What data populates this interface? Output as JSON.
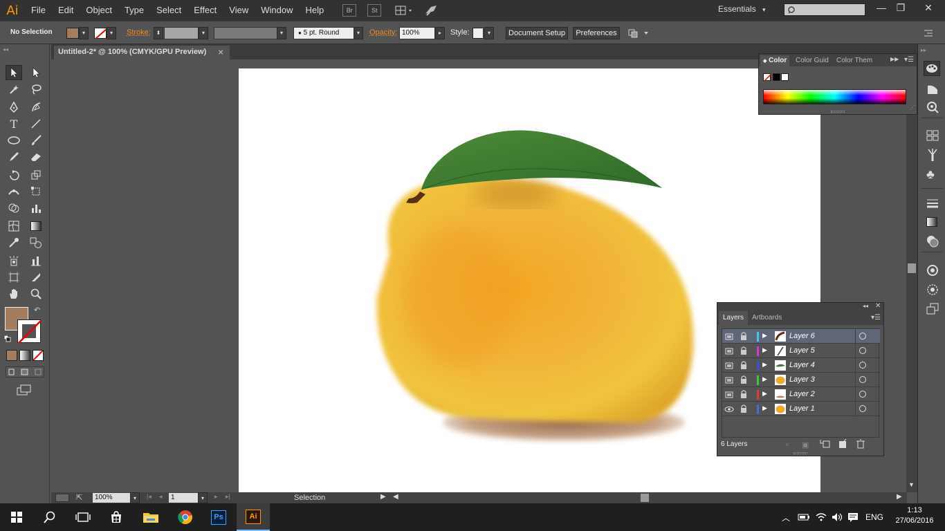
{
  "app": {
    "logo_text": "Ai"
  },
  "menu": [
    "File",
    "Edit",
    "Object",
    "Type",
    "Select",
    "Effect",
    "View",
    "Window",
    "Help"
  ],
  "menu_buttons": {
    "br": "Br",
    "st": "St"
  },
  "workspace": {
    "label": "Essentials",
    "arrow": "▾"
  },
  "window_controls": {
    "minimize": "—",
    "restore": "❐",
    "close": "✕"
  },
  "control_bar": {
    "selection_status": "No Selection",
    "stroke_label": "Stroke:",
    "brush_value": "5 pt. Round",
    "opacity_label": "Opacity:",
    "opacity_value": "100%",
    "style_label": "Style:",
    "document_setup": "Document Setup",
    "preferences": "Preferences"
  },
  "document_tab": {
    "title": "Untitled-2* @ 100% (CMYK/GPU Preview)",
    "close": "×"
  },
  "colors": {
    "fill": "#a47d5e",
    "accent_orange": "#f08a24",
    "selected_layer": "#5f6677"
  },
  "color_panel": {
    "tabs": [
      "Color",
      "Color Guide",
      "Color Themes"
    ],
    "tab_labels_visible": [
      "Color",
      "Color Guid",
      "Color Them"
    ]
  },
  "layers_panel": {
    "tabs": [
      "Layers",
      "Artboards"
    ],
    "layers": [
      {
        "name": "Layer 6",
        "color": "#43c6f0",
        "selected": true,
        "visible_icon": "eye-hidden"
      },
      {
        "name": "Layer 5",
        "color": "#d23ad1",
        "selected": false,
        "visible_icon": "eye-hidden"
      },
      {
        "name": "Layer 4",
        "color": "#3a4fd8",
        "selected": false,
        "visible_icon": "eye-hidden"
      },
      {
        "name": "Layer 3",
        "color": "#3cc83c",
        "selected": false,
        "visible_icon": "eye-hidden"
      },
      {
        "name": "Layer 2",
        "color": "#e03b3b",
        "selected": false,
        "visible_icon": "eye-hidden"
      },
      {
        "name": "Layer 1",
        "color": "#4a6ad8",
        "selected": false,
        "visible_icon": "eye"
      }
    ],
    "count_label": "6 Layers"
  },
  "status_bar": {
    "zoom": "100%",
    "page": "1",
    "tool_status": "Selection"
  },
  "taskbar": {
    "language": "ENG",
    "time": "1:13",
    "date": "27/06/2016",
    "apps": [
      "start-icon",
      "search-icon",
      "task-view-icon",
      "store-icon",
      "file-explorer-icon",
      "chrome-icon",
      "photoshop-icon",
      "illustrator-icon"
    ],
    "ps_label": "Ps",
    "ai_label": "Ai"
  }
}
